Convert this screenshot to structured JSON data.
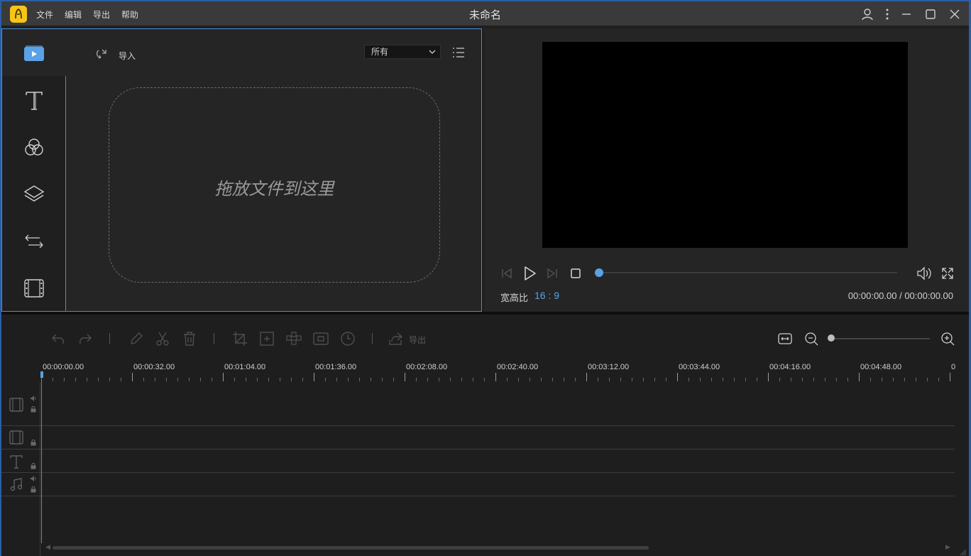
{
  "app": {
    "title": "未命名",
    "menu": [
      "文件",
      "编辑",
      "导出",
      "帮助"
    ]
  },
  "media_panel": {
    "side_tabs": [
      "media-icon",
      "text-icon",
      "filter-icon",
      "overlay-icon",
      "transition-icon",
      "film-icon"
    ],
    "import_label": "导入",
    "filter_value": "所有",
    "drop_text": "拖放文件到这里"
  },
  "preview": {
    "aspect_label": "宽高比",
    "aspect_value": "16 : 9",
    "time_readout": "00:00:00.00 / 00:00:00.00",
    "progress_fraction": 0
  },
  "timeline": {
    "export_label": "导出",
    "ruler_labels": [
      "00:00:00.00",
      "00:00:32.00",
      "00:01:04.00",
      "00:01:36.00",
      "00:02:08.00",
      "00:02:40.00",
      "00:03:12.00",
      "00:03:44.00",
      "00:04:16.00",
      "00:04:48.00",
      "0"
    ],
    "zoom_fraction": 0
  },
  "colors": {
    "accent": "#5aa2e8",
    "logo": "#f5c518",
    "panel_border": "#4a8fd6"
  }
}
